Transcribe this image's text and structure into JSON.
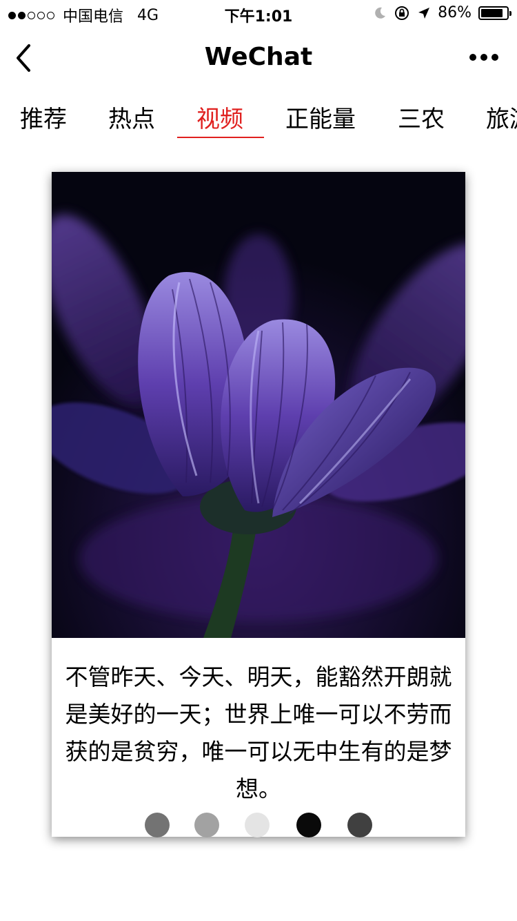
{
  "status_bar": {
    "carrier": "中国电信",
    "network": "4G",
    "time": "下午1:01",
    "battery": "86%",
    "battery_level": 0.86,
    "signal_strength": 2,
    "icons": [
      "moon-icon",
      "rotation-lock-icon",
      "location-arrow-icon",
      "battery-icon"
    ]
  },
  "nav": {
    "title": "WeChat",
    "back_icon": "chevron-left-icon",
    "more_icon": "more-dots-icon"
  },
  "tabs": [
    {
      "label": "推荐"
    },
    {
      "label": "热点"
    },
    {
      "label": "视频"
    },
    {
      "label": "正能量"
    },
    {
      "label": "三农"
    },
    {
      "label": "旅游"
    }
  ],
  "active_tab_index": 2,
  "colors": {
    "accent": "#e0201f",
    "photo_background": "#070714"
  },
  "card": {
    "caption": "不管昨天、今天、明天，能豁然开朗就是美好的一天；世界上唯一可以不劳而获的是贫穷，唯一可以无中生有的是梦想。",
    "photo_subject": "purple-flower-photo",
    "pagination_dots": [
      {
        "color": "#737373"
      },
      {
        "color": "#a2a2a2"
      },
      {
        "color": "#e4e4e4"
      },
      {
        "color": "#0a0a0a"
      },
      {
        "color": "#404040"
      }
    ]
  }
}
